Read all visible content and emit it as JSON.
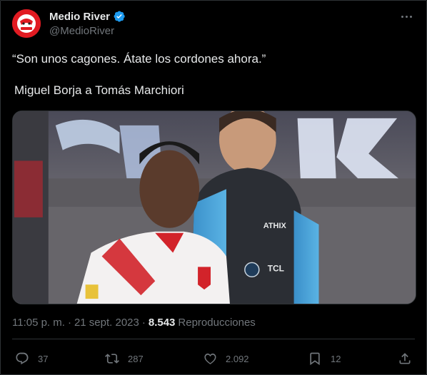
{
  "author": {
    "display_name": "Medio River",
    "handle": "@MedioRiver",
    "verified": true,
    "avatar_color": "#e11b22"
  },
  "tweet": {
    "line1": "“Son unos cagones. Átate los cordones ahora.”",
    "line2": "Miguel Borja a Tomás Marchiori"
  },
  "meta": {
    "time": "11:05 p. m.",
    "separator": "·",
    "date": "21 sept. 2023",
    "separator2": "·",
    "views_count": "8.543",
    "views_label": "Reproducciones"
  },
  "actions": {
    "replies": "37",
    "reposts": "287",
    "likes": "2.092",
    "bookmarks": "12"
  },
  "colors": {
    "background": "#000000",
    "text": "#e7e9ea",
    "muted": "#71767b",
    "divider": "#2f3336",
    "verified": "#1d9bf0"
  },
  "icons": {
    "avatar": "medio-river-logo",
    "verified": "verified-badge-icon",
    "more": "more-options-icon",
    "reply": "reply-icon",
    "repost": "repost-icon",
    "like": "like-icon",
    "bookmark": "bookmark-icon",
    "share": "share-icon"
  }
}
